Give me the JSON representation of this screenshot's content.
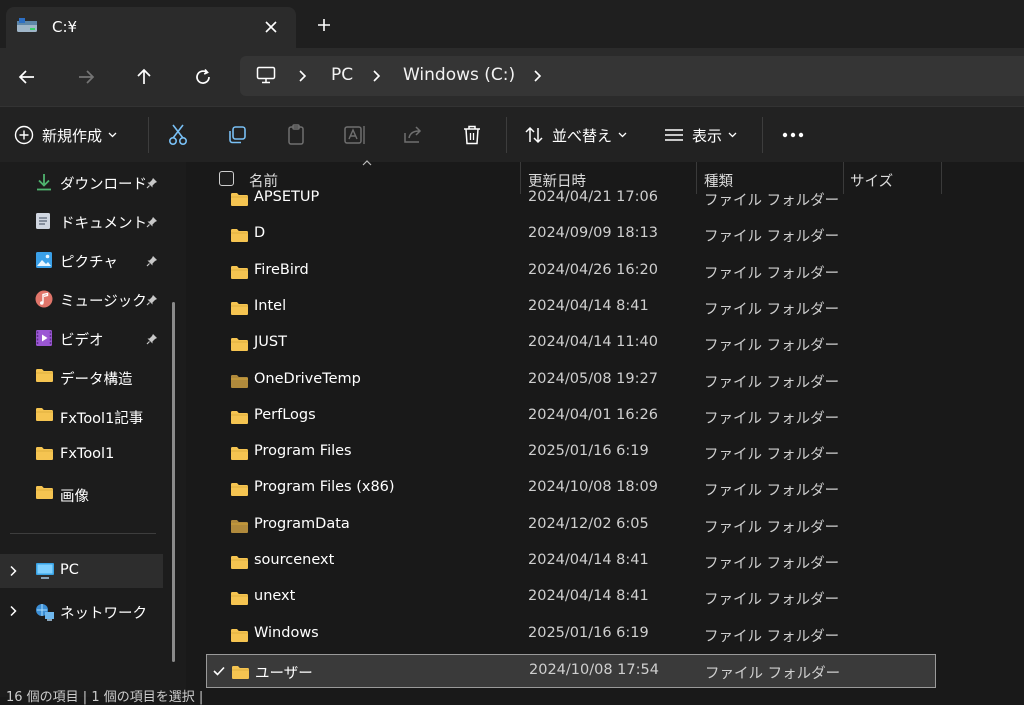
{
  "tab": {
    "title": "C:¥",
    "icon": "drive-icon",
    "close": "close-icon",
    "new_tab": "plus-icon"
  },
  "nav": {
    "back": "arrow-left-icon",
    "forward": "arrow-right-icon",
    "up": "arrow-up-icon",
    "refresh": "refresh-icon",
    "breadcrumb": [
      "PC",
      "Windows (C:)"
    ]
  },
  "toolbar": {
    "new_label": "新規作成",
    "sort_label": "並べ替え",
    "view_label": "表示",
    "more": "ellipsis-icon"
  },
  "sidebar": {
    "quick_access": [
      {
        "label": "ダウンロード",
        "icon": "download-icon",
        "pinned": true,
        "color": "#4fb36f"
      },
      {
        "label": "ドキュメント",
        "icon": "document-icon",
        "pinned": true,
        "color": "#d0d6e0"
      },
      {
        "label": "ピクチャ",
        "icon": "picture-icon",
        "pinned": true,
        "color": "#3aa0e8"
      },
      {
        "label": "ミュージック",
        "icon": "music-icon",
        "pinned": true,
        "color": "#e0756a"
      },
      {
        "label": "ビデオ",
        "icon": "video-icon",
        "pinned": true,
        "color": "#9b57d3"
      },
      {
        "label": "データ構造",
        "icon": "folder-icon",
        "pinned": false,
        "color": "#f5c451"
      },
      {
        "label": "FxTool1記事",
        "icon": "folder-icon",
        "pinned": false,
        "color": "#f5c451"
      },
      {
        "label": "FxTool1",
        "icon": "folder-icon",
        "pinned": false,
        "color": "#f5c451"
      },
      {
        "label": "画像",
        "icon": "folder-icon",
        "pinned": false,
        "color": "#f5c451"
      }
    ],
    "pc_label": "PC",
    "network_label": "ネットワーク"
  },
  "columns": {
    "name": "名前",
    "date": "更新日時",
    "type": "種類",
    "size": "サイズ"
  },
  "files": [
    {
      "name": "APSETUP",
      "date": "2024/04/21 17:06",
      "type": "ファイル フォルダー",
      "color": "#f5c451"
    },
    {
      "name": "D",
      "date": "2024/09/09 18:13",
      "type": "ファイル フォルダー",
      "color": "#f5c451"
    },
    {
      "name": "FireBird",
      "date": "2024/04/26 16:20",
      "type": "ファイル フォルダー",
      "color": "#f5c451"
    },
    {
      "name": "Intel",
      "date": "2024/04/14 8:41",
      "type": "ファイル フォルダー",
      "color": "#f5c451"
    },
    {
      "name": "JUST",
      "date": "2024/04/14 11:40",
      "type": "ファイル フォルダー",
      "color": "#f5c451"
    },
    {
      "name": "OneDriveTemp",
      "date": "2024/05/08 19:27",
      "type": "ファイル フォルダー",
      "color": "#b08a3c"
    },
    {
      "name": "PerfLogs",
      "date": "2024/04/01 16:26",
      "type": "ファイル フォルダー",
      "color": "#f5c451"
    },
    {
      "name": "Program Files",
      "date": "2025/01/16 6:19",
      "type": "ファイル フォルダー",
      "color": "#f5c451"
    },
    {
      "name": "Program Files (x86)",
      "date": "2024/10/08 18:09",
      "type": "ファイル フォルダー",
      "color": "#f5c451"
    },
    {
      "name": "ProgramData",
      "date": "2024/12/02 6:05",
      "type": "ファイル フォルダー",
      "color": "#b08a3c"
    },
    {
      "name": "sourcenext",
      "date": "2024/04/14 8:41",
      "type": "ファイル フォルダー",
      "color": "#f5c451"
    },
    {
      "name": "unext",
      "date": "2024/04/14 8:41",
      "type": "ファイル フォルダー",
      "color": "#f5c451"
    },
    {
      "name": "Windows",
      "date": "2025/01/16 6:19",
      "type": "ファイル フォルダー",
      "color": "#f5c451"
    },
    {
      "name": "ユーザー",
      "date": "2024/10/08 17:54",
      "type": "ファイル フォルダー",
      "color": "#f5c451",
      "selected": true
    }
  ],
  "status": "16 個の項目  |  1 個の項目を選択  |"
}
